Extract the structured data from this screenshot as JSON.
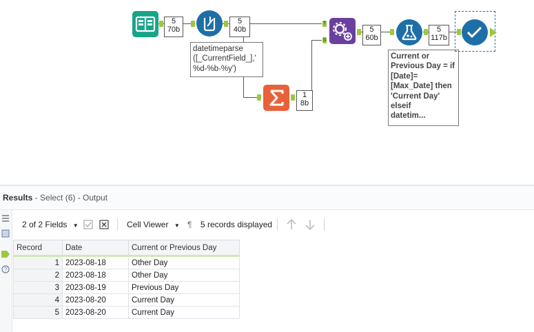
{
  "workflow": {
    "counts": [
      {
        "records": "5",
        "size": "70b"
      },
      {
        "records": "5",
        "size": "40b"
      },
      {
        "records": "1",
        "size": "8b"
      },
      {
        "records": "5",
        "size": "60b"
      },
      {
        "records": "5",
        "size": "117b"
      }
    ],
    "join_anchor_top": "T",
    "join_anchor_bottom": "S",
    "annotation_datetime": "datetimeparse\n([_CurrentField_],'\n%d-%b-%y')",
    "annotation_formula": "Current or\nPrevious Day = if\n[Date]=\n[Max_Date] then\n'Current Day'\nelseif\ndatetim..."
  },
  "results": {
    "title": "Results",
    "subtitle": " - Select (6) - Output",
    "fields_label": "2 of 2 Fields",
    "viewer_label": "Cell Viewer",
    "pilcrow": "¶",
    "records_displayed": "5 records displayed",
    "columns": [
      "Record",
      "Date",
      "Current or Previous Day"
    ],
    "rows": [
      [
        "1",
        "2023-08-18",
        "Other Day"
      ],
      [
        "2",
        "2023-08-18",
        "Other Day"
      ],
      [
        "3",
        "2023-08-19",
        "Previous Day"
      ],
      [
        "4",
        "2023-08-20",
        "Current Day"
      ],
      [
        "5",
        "2023-08-20",
        "Current Day"
      ]
    ]
  }
}
